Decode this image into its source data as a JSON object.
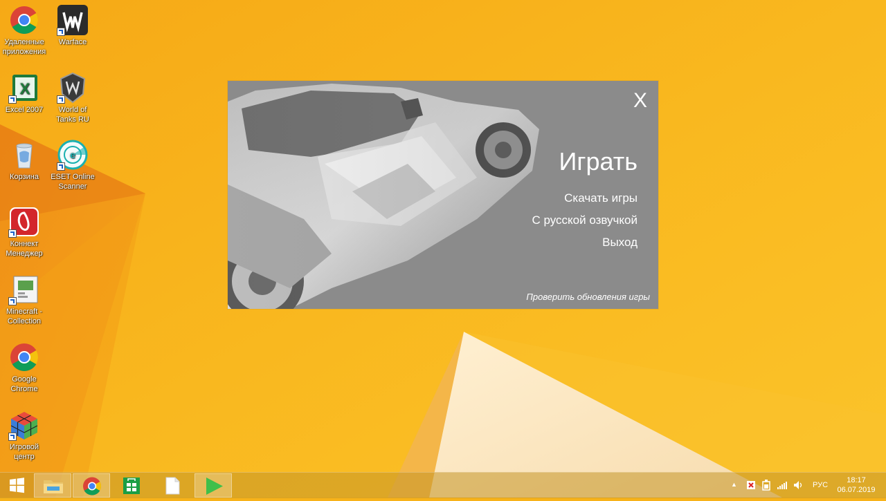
{
  "desktop": {
    "icons": [
      {
        "label": "Удаленные приложения",
        "icon": "chrome-icon"
      },
      {
        "label": "Warface",
        "icon": "warface-icon"
      },
      {
        "label": "Excel 2007",
        "icon": "excel-icon"
      },
      {
        "label": "World of Tanks RU",
        "icon": "world-of-tanks-icon"
      },
      {
        "label": "Корзина",
        "icon": "recycle-bin-icon"
      },
      {
        "label": "ESET Online Scanner",
        "icon": "eset-icon"
      },
      {
        "label": "Коннект Менеджер",
        "icon": "connect-manager-icon"
      },
      {
        "label": "Minecraft - Collection",
        "icon": "minecraft-icon"
      },
      {
        "label": "Google Chrome",
        "icon": "chrome-icon"
      },
      {
        "label": "Игровой центр",
        "icon": "game-center-icon"
      }
    ]
  },
  "launcher": {
    "close_label": "X",
    "play_label": "Играть",
    "menu_items": [
      "Скачать игры",
      "С русской озвучкой",
      "Выход"
    ],
    "update_link": "Проверить обновления игры"
  },
  "taskbar": {
    "buttons": [
      "start-icon",
      "file-explorer-icon",
      "chrome-icon",
      "store-icon",
      "document-icon",
      "play-icon"
    ],
    "tray": {
      "language": "РУС",
      "time": "18:17",
      "date": "06.07.2019"
    }
  },
  "colors": {
    "wallpaper": "#f7b21a",
    "launcher_bg": "#8b8b8b",
    "accent_green": "#4caf50"
  }
}
